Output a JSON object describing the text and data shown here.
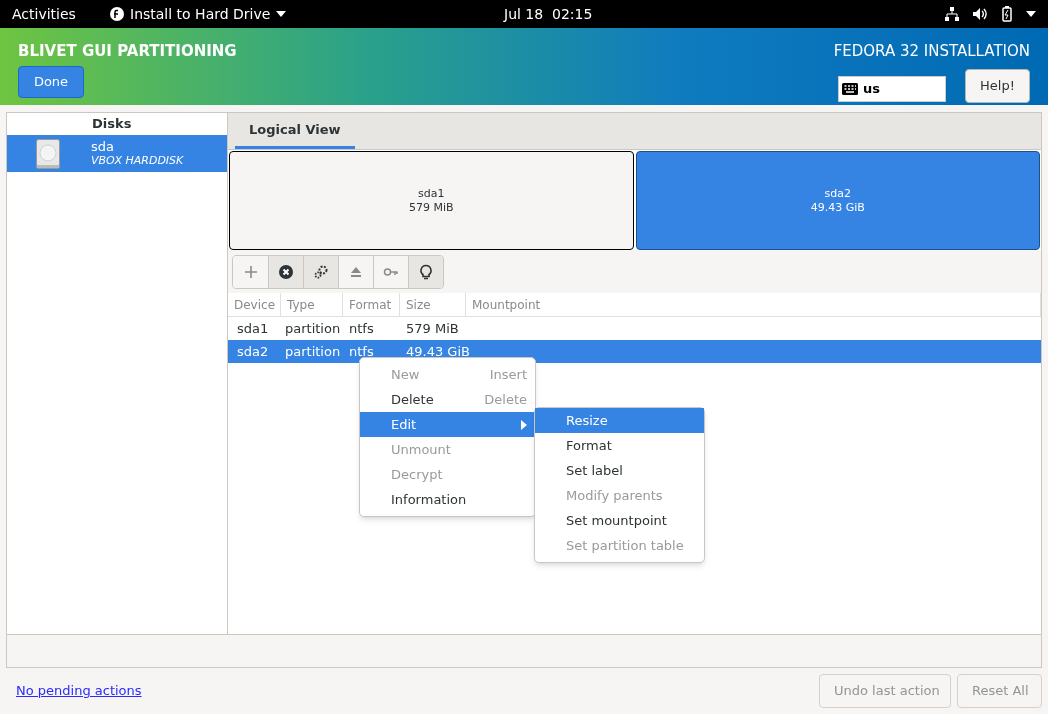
{
  "top_bar": {
    "activities": "Activities",
    "app_menu": "Install to Hard Drive",
    "clock": "Jul 18  02:15"
  },
  "header": {
    "title": "BLIVET GUI PARTITIONING",
    "done": "Done",
    "product": "FEDORA 32 INSTALLATION",
    "keyboard": "us",
    "help": "Help!"
  },
  "disks": {
    "heading": "Disks",
    "items": [
      {
        "name": "sda",
        "model": "VBOX HARDDISK",
        "selected": true
      }
    ]
  },
  "tabs": [
    {
      "label": "Logical View",
      "selected": true
    }
  ],
  "partitions": [
    {
      "name": "sda1",
      "size": "579 MiB",
      "selected": false
    },
    {
      "name": "sda2",
      "size": "49.43 GiB",
      "selected": true
    }
  ],
  "toolbar": [
    {
      "kind": "add",
      "disabled": true
    },
    {
      "kind": "delete",
      "disabled": false
    },
    {
      "kind": "settings",
      "disabled": false
    },
    {
      "kind": "eject",
      "disabled": true
    },
    {
      "kind": "key",
      "disabled": true
    },
    {
      "kind": "info",
      "disabled": false
    }
  ],
  "table": {
    "columns": [
      "Device",
      "Type",
      "Format",
      "Size",
      "Mountpoint"
    ],
    "rows": [
      {
        "cells": [
          "sda1",
          "partition",
          "ntfs",
          "579 MiB",
          ""
        ],
        "selected": false
      },
      {
        "cells": [
          "sda2",
          "partition",
          "ntfs",
          "49.43 GiB",
          ""
        ],
        "selected": true
      }
    ]
  },
  "context_menu": [
    {
      "label": "New",
      "shortcut": "Insert",
      "disabled": true,
      "selected": false
    },
    {
      "label": "Delete",
      "shortcut": "Delete",
      "disabled": false,
      "selected": false
    },
    {
      "label": "Edit",
      "disabled": false,
      "selected": true,
      "submenu": true
    },
    {
      "label": "Unmount",
      "disabled": true,
      "selected": false
    },
    {
      "label": "Decrypt",
      "disabled": true,
      "selected": false
    },
    {
      "label": "Information",
      "disabled": false,
      "selected": false
    }
  ],
  "submenu": [
    {
      "label": "Resize",
      "disabled": false,
      "selected": true
    },
    {
      "label": "Format",
      "disabled": false,
      "selected": false
    },
    {
      "label": "Set label",
      "disabled": false,
      "selected": false
    },
    {
      "label": "Modify parents",
      "disabled": true,
      "selected": false
    },
    {
      "label": "Set mountpoint",
      "disabled": false,
      "selected": false
    },
    {
      "label": "Set partition table",
      "disabled": true,
      "selected": false
    }
  ],
  "footer": {
    "link": "No pending actions",
    "buttons": [
      {
        "label": "Undo last action",
        "disabled": true
      },
      {
        "label": "Reset All",
        "disabled": true
      }
    ]
  }
}
